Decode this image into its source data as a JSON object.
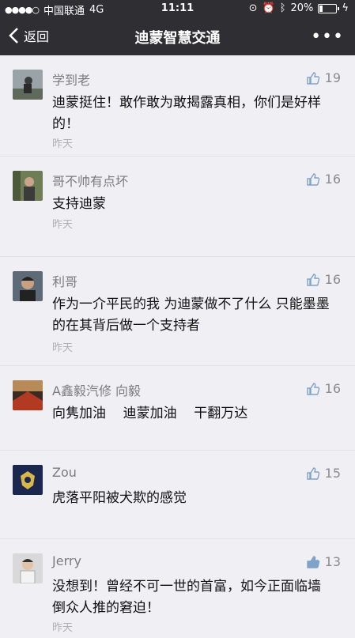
{
  "status_bar": {
    "signal": "●●●●○",
    "carrier": "中国联通",
    "network": "4G",
    "time": "11:11",
    "battery": "20%",
    "battery_level": 0.2
  },
  "nav": {
    "back_label": "返回",
    "title": "迪蒙智慧交通",
    "more_label": "•••"
  },
  "comments": [
    {
      "name": "学到老",
      "likes": "19",
      "text": "迪蒙挺住！敢作敢为敢揭露真相，你们是好样的！",
      "time": "昨天"
    },
    {
      "name": "哥不帅有点坏",
      "likes": "16",
      "text": "支持迪蒙",
      "time": "昨天"
    },
    {
      "name": "利哥",
      "likes": "16",
      "text": "作为一介平民的我  为迪蒙做不了什么  只能墨墨的在其背后做一个支持者",
      "time": "昨天"
    },
    {
      "name": "A鑫毅汽修 向毅",
      "likes": "16",
      "text": "向隽加油    迪蒙加油    干翻万达",
      "time": ""
    },
    {
      "name": "Zou",
      "likes": "15",
      "text": "虎落平阳被犬欺的感觉",
      "time": ""
    },
    {
      "name": "Jerry",
      "likes": "13",
      "text": "没想到！曾经不可一世的首富，如今正面临墙倒众人推的窘迫！",
      "time": "昨天"
    }
  ]
}
